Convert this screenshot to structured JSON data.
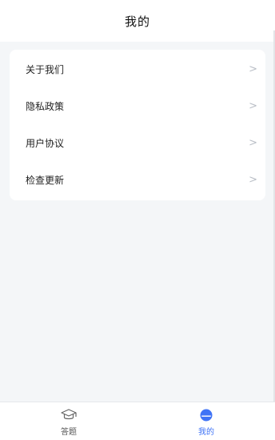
{
  "header": {
    "title": "我的"
  },
  "menu": {
    "items": [
      {
        "label": "关于我们",
        "chevron": ">"
      },
      {
        "label": "隐私政策",
        "chevron": ">"
      },
      {
        "label": "用户协议",
        "chevron": ">"
      },
      {
        "label": "检查更新",
        "chevron": ">"
      }
    ]
  },
  "tabbar": {
    "tabs": [
      {
        "label": "答题",
        "icon": "graduation-cap-icon",
        "active": false
      },
      {
        "label": "我的",
        "icon": "user-icon",
        "active": true
      }
    ]
  },
  "colors": {
    "accent": "#3f73f6",
    "background": "#f4f6f8",
    "card": "#ffffff"
  }
}
